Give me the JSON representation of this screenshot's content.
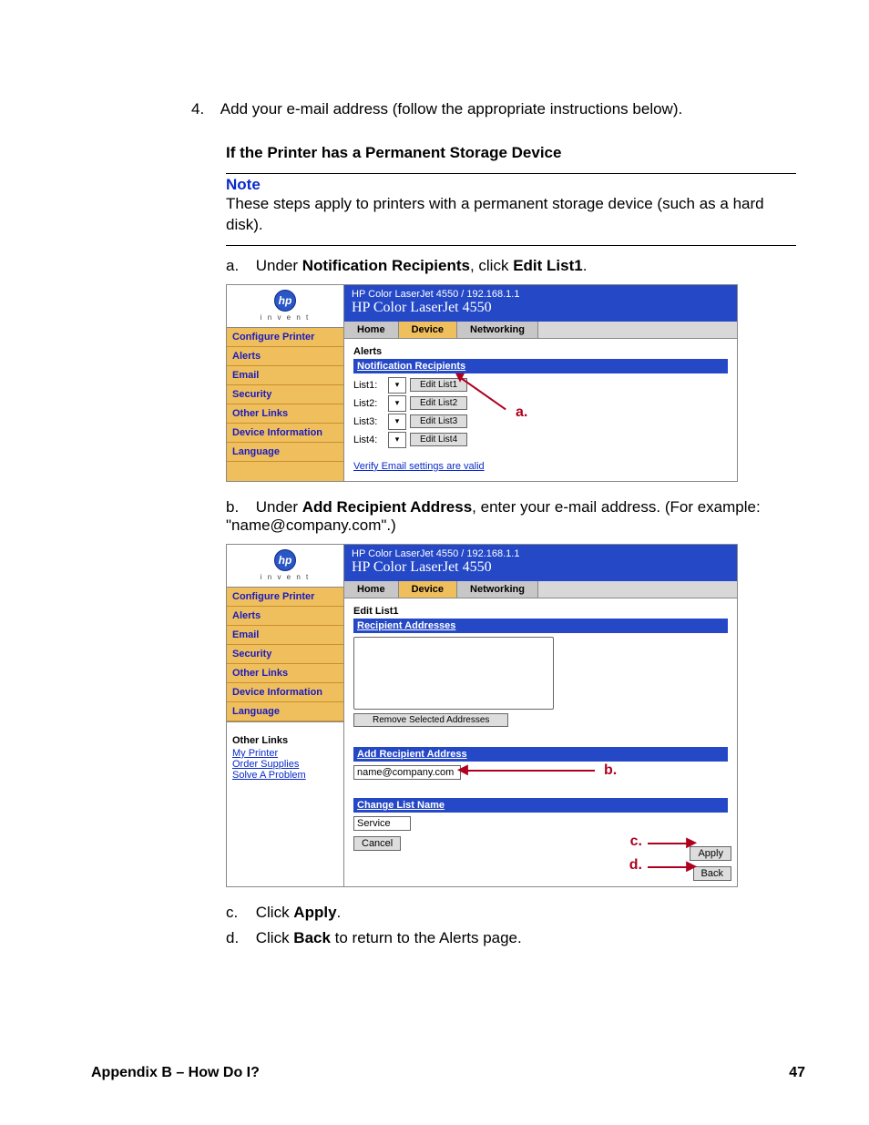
{
  "step4": {
    "number": "4.",
    "text": "Add your e-mail address (follow the appropriate instructions below)."
  },
  "heading": "If the Printer has a Permanent Storage Device",
  "note": {
    "label": "Note",
    "body": "These steps apply to printers with a permanent storage device (such as a hard disk)."
  },
  "stepA": {
    "letter": "a.",
    "pre": "Under ",
    "bold1": "Notification Recipients",
    "mid": ", click ",
    "bold2": "Edit List1",
    "post": "."
  },
  "stepB": {
    "letter": "b.",
    "pre": "Under ",
    "bold1": "Add Recipient Address",
    "mid": ", enter your e-mail address. (For example: \"name@company.com\".)"
  },
  "stepC": {
    "letter": "c.",
    "pre": "Click ",
    "bold1": "Apply",
    "post": "."
  },
  "stepD": {
    "letter": "d.",
    "pre": "Click ",
    "bold1": "Back",
    "post": " to return to the Alerts page."
  },
  "printer": {
    "breadcrumb": "HP Color LaserJet 4550 / 192.168.1.1",
    "title": "HP Color LaserJet 4550",
    "logo_text": "hp",
    "invent": "i n v e n t",
    "tabs": {
      "home": "Home",
      "device": "Device",
      "networking": "Networking"
    },
    "sidebar": [
      "Configure Printer",
      "Alerts",
      "Email",
      "Security",
      "Other Links",
      "Device Information",
      "Language"
    ],
    "other_links_head": "Other Links",
    "other_links": [
      "My Printer",
      "Order Supplies",
      "Solve A Problem"
    ],
    "alerts": {
      "title": "Alerts",
      "bar": "Notification Recipients",
      "lists": [
        {
          "label": "List1:",
          "btn": "Edit List1"
        },
        {
          "label": "List2:",
          "btn": "Edit List2"
        },
        {
          "label": "List3:",
          "btn": "Edit List3"
        },
        {
          "label": "List4:",
          "btn": "Edit List4"
        }
      ],
      "verify": "Verify Email settings are valid"
    },
    "editlist": {
      "title": "Edit List1",
      "bar1": "Recipient Addresses",
      "remove_btn": "Remove Selected Addresses",
      "bar2": "Add Recipient Address",
      "input_value": "name@company.com",
      "bar3": "Change List Name",
      "name_value": "Service",
      "cancel": "Cancel",
      "apply": "Apply",
      "back": "Back"
    }
  },
  "callouts": {
    "a": "a.",
    "b": "b.",
    "c": "c.",
    "d": "d."
  },
  "footer": {
    "left": "Appendix B – How Do I?",
    "right": "47"
  }
}
